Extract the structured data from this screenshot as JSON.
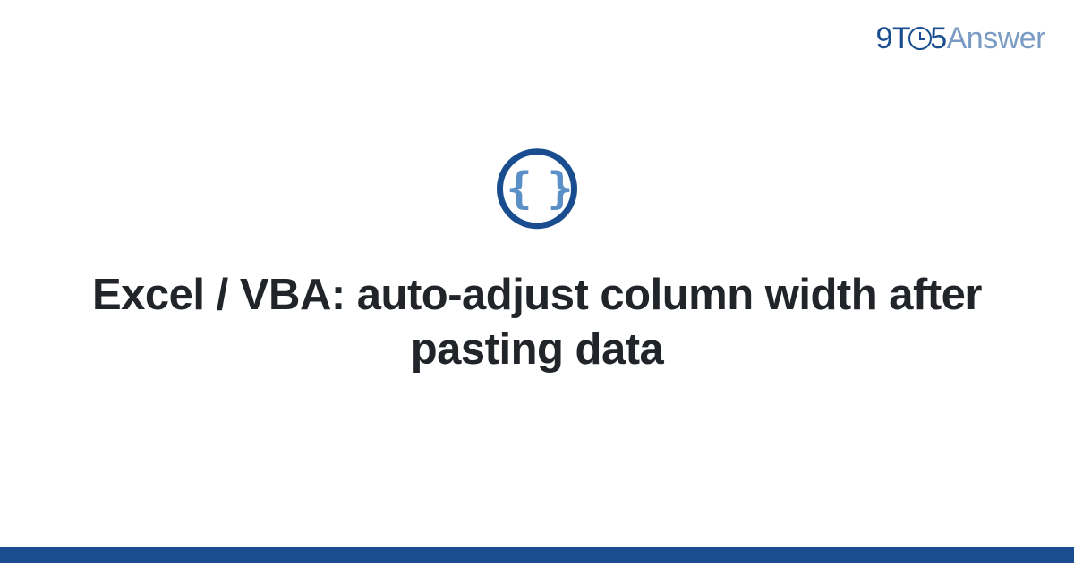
{
  "logo": {
    "part1": "9T",
    "part2": "5",
    "part3": "Answer"
  },
  "icon": {
    "braces": "{ }"
  },
  "title": "Excel / VBA: auto-adjust column width after pasting data",
  "colors": {
    "primary": "#1a4d8f",
    "secondary": "#7a9bc4",
    "iconBrace": "#5a8fc7",
    "text": "#212529"
  }
}
